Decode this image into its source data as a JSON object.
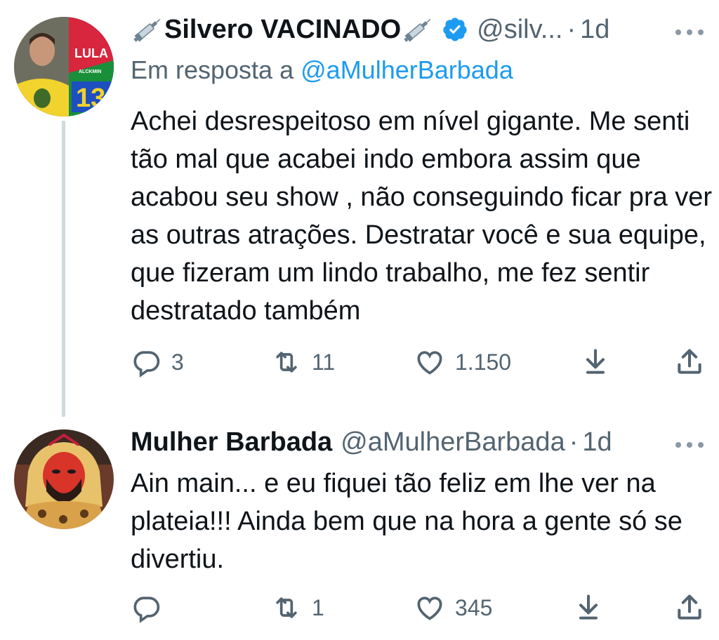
{
  "tweets": [
    {
      "author_name": "Silvero VACINADO",
      "handle": "@silv...",
      "time": "1d",
      "reply_to_prefix": "Em resposta a",
      "reply_to_mention": "@aMulherBarbada",
      "text": "Achei desrespeitoso em nível gigante. Me senti tão mal que acabei indo embora assim que acabou seu show , não conseguindo ficar pra ver as outras atrações. Destratar você e sua equipe, que fizeram um lindo trabalho, me fez sentir destratado também",
      "avatar_text": {
        "top": "LULA",
        "sub": "ALCKMIN",
        "number": "13"
      },
      "replies": "3",
      "retweets": "11",
      "likes": "1.150"
    },
    {
      "author_name": "Mulher Barbada",
      "handle": "@aMulherBarbada",
      "time": "1d",
      "text": "Ain main... e eu fiquei tão feliz em lhe ver na plateia!!! Ainda bem que na hora a gente só se divertiu.",
      "replies": "",
      "retweets": "1",
      "likes": "345"
    }
  ],
  "colors": {
    "text": "#0f1419",
    "secondary": "#536471",
    "link": "#1d9bf0",
    "thread_line": "#cfd9de"
  },
  "icons": [
    "syringe-icon",
    "verified-badge-icon",
    "more-icon",
    "reply-icon",
    "retweet-icon",
    "like-icon",
    "download-icon",
    "share-icon"
  ]
}
